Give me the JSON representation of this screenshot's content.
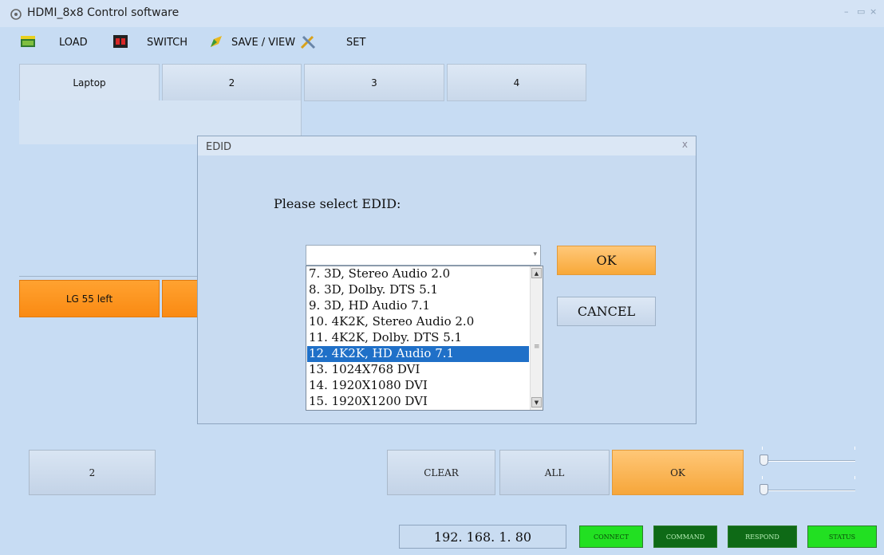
{
  "app": {
    "title": "HDMI_8x8 Control software",
    "minimize": "–",
    "maximize": "▭",
    "close": "×"
  },
  "toolbar": {
    "load_label": "LOAD",
    "switch_label": "SWITCH",
    "save_view_label": "SAVE / VIEW",
    "set_label": "SET"
  },
  "input_tabs": [
    "Laptop",
    "2",
    "3",
    "4"
  ],
  "outputs": {
    "visible_output": "LG 55 left"
  },
  "dialog": {
    "title": "EDID",
    "close": "x",
    "prompt": "Please select EDID:",
    "select_value": "",
    "options": [
      "7. 3D, Stereo Audio 2.0",
      "8. 3D, Dolby. DTS 5.1",
      "9. 3D, HD Audio 7.1",
      "10. 4K2K, Stereo Audio 2.0",
      "11. 4K2K, Dolby. DTS 5.1",
      "12. 4K2K, HD Audio 7.1",
      "13. 1024X768 DVI",
      "14. 1920X1080 DVI",
      "15. 1920X1200 DVI"
    ],
    "selected_option": "12. 4K2K, HD Audio 7.1",
    "ok_label": "OK",
    "cancel_label": "CANCEL"
  },
  "bottom": {
    "input_2_label": "2",
    "clear_label": "CLEAR",
    "all_label": "ALL",
    "ok_label": "OK"
  },
  "status": {
    "ip": "192. 168. 1. 80",
    "connect": "CONNECT",
    "command": "COMMAND",
    "respond": "RESPOND",
    "status": "STATUS"
  },
  "colors": {
    "background": "#c7dcf3",
    "accent_orange": "#fa8a12",
    "selection_blue": "#1f70c8",
    "status_green_bright": "#22e022",
    "status_green_dark": "#0e6a16"
  },
  "icons": [
    "app-logo-icon",
    "load-icon",
    "switch-icon",
    "save-view-icon",
    "set-tools-icon"
  ]
}
